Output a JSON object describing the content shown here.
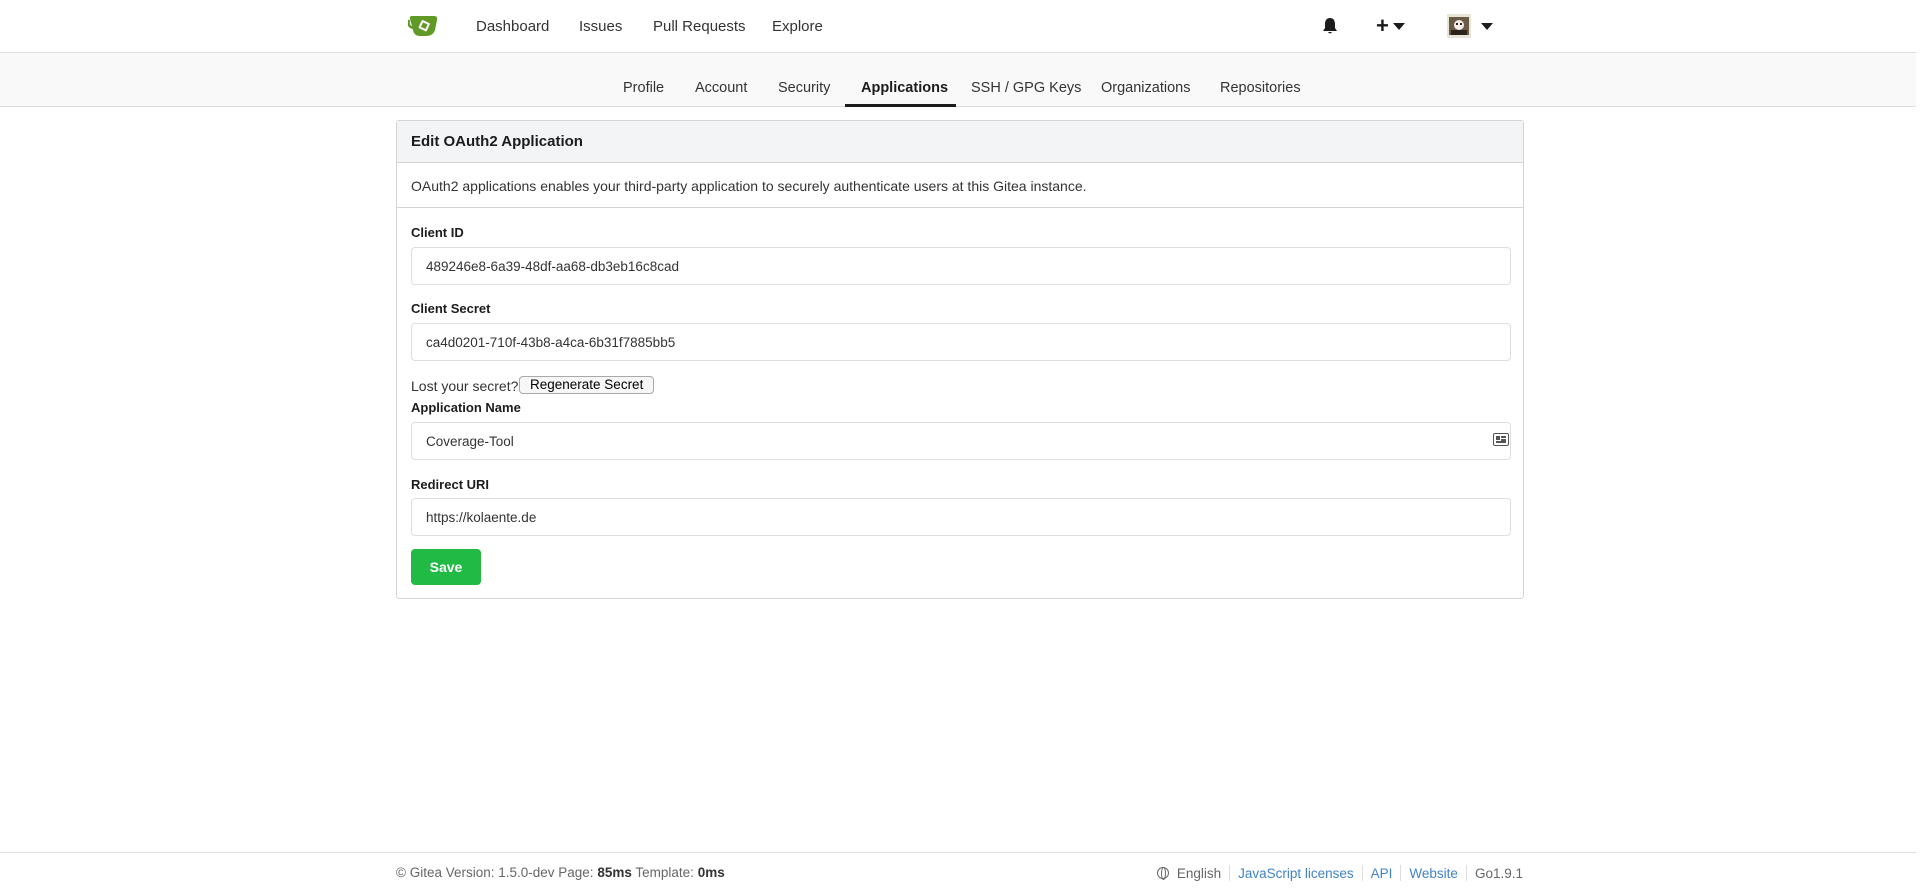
{
  "topnav": {
    "items": [
      "Dashboard",
      "Issues",
      "Pull Requests",
      "Explore"
    ],
    "plus_label": "+"
  },
  "subnav": {
    "tabs": [
      "Profile",
      "Account",
      "Security",
      "Applications",
      "SSH / GPG Keys",
      "Organizations",
      "Repositories"
    ],
    "active": "Applications"
  },
  "form": {
    "header": "Edit OAuth2 Application",
    "description": "OAuth2 applications enables your third-party application to securely authenticate users at this Gitea instance.",
    "client_id_label": "Client ID",
    "client_id_value": "489246e8-6a39-48df-aa68-db3eb16c8cad",
    "client_secret_label": "Client Secret",
    "client_secret_value": "ca4d0201-710f-43b8-a4ca-6b31f7885bb5",
    "lost_secret_text": "Lost your secret?",
    "regenerate_label": "Regenerate Secret",
    "app_name_label": "Application Name",
    "app_name_value": "Coverage-Tool",
    "redirect_label": "Redirect URI",
    "redirect_value": "https://kolaente.de",
    "save_label": "Save"
  },
  "footer": {
    "copyright": "© Gitea Version: 1.5.0-dev Page:",
    "page_time": "85ms",
    "template_label": "Template:",
    "template_time": "0ms",
    "language": "English",
    "links": [
      "JavaScript licenses",
      "API",
      "Website"
    ],
    "go_version": "Go1.9.1"
  },
  "colors": {
    "accent_green": "#21ba45",
    "link_blue": "#4183c4",
    "logo_green": "#609926"
  },
  "icons": [
    "gitea-logo-icon",
    "bell-icon",
    "plus-icon",
    "avatar",
    "id-card-icon",
    "globe-icon"
  ]
}
